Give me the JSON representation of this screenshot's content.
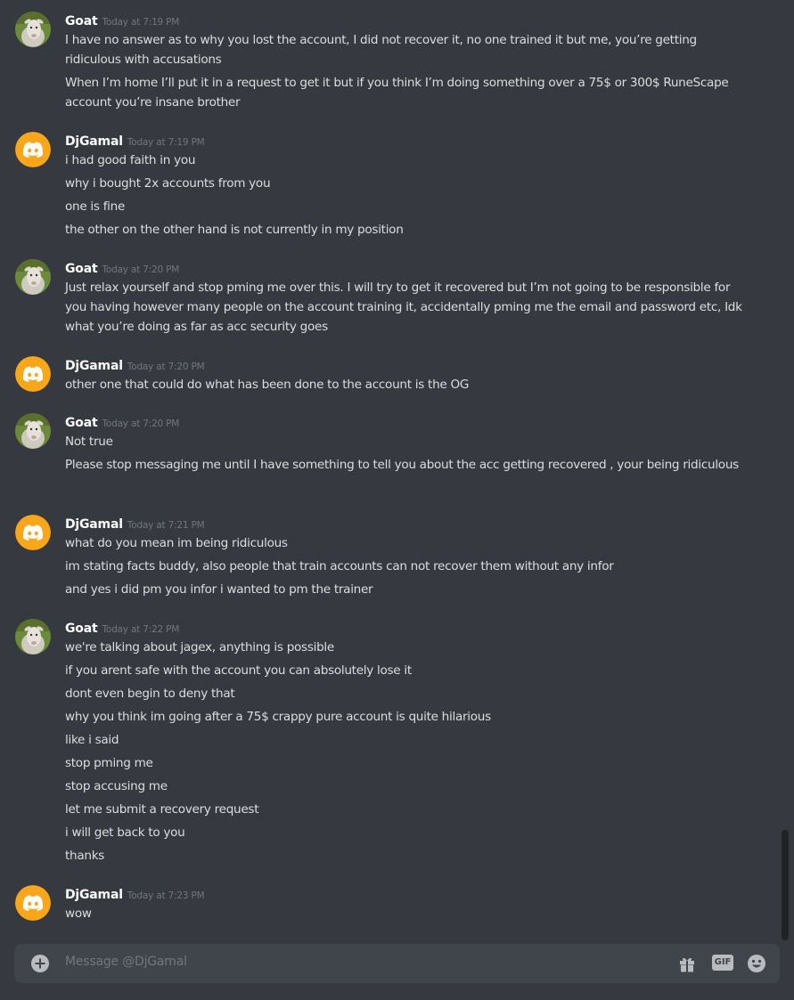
{
  "colors": {
    "background": "#36393f",
    "composer_bg": "#40444b",
    "username": "#ffffff",
    "timestamp": "#72767d",
    "text": "#dcddde",
    "discord_avatar": "#faa61a"
  },
  "conversation": [
    {
      "user": "Goat",
      "avatar": "goat-avatar",
      "time": "Today at 7:19 PM",
      "lines": [
        "I have no answer as to why you lost the account, I did not recover it, no one trained it but me, you’re getting ridiculous with accusations",
        "When I’m home I’ll put it in a request to get it but if you think I’m doing something over a 75$ or 300$ RuneScape account you’re insane brother"
      ]
    },
    {
      "user": "DjGamal",
      "avatar": "discord-avatar",
      "time": "Today at 7:19 PM",
      "lines": [
        "i had good faith in you",
        "why i bought 2x accounts from you",
        "one is fine",
        "the other on the other hand is not currently in my position"
      ]
    },
    {
      "user": "Goat",
      "avatar": "goat-avatar",
      "time": "Today at 7:20 PM",
      "lines": [
        "Just relax yourself and stop pming me over this. I will try to get it recovered but I’m not going to be responsible for you having however many people on the account training it, accidentally pming me the email and password etc, Idk what you’re doing as far as acc security goes"
      ]
    },
    {
      "user": "DjGamal",
      "avatar": "discord-avatar",
      "time": "Today at 7:20 PM",
      "lines": [
        "other one that could do what has been done to the account is the OG"
      ]
    },
    {
      "user": "Goat",
      "avatar": "goat-avatar",
      "time": "Today at 7:20 PM",
      "lines": [
        "Not true",
        "Please stop messaging me until I have something to tell you about the acc getting recovered , your being ridiculous"
      ]
    },
    {
      "user": "DjGamal",
      "avatar": "discord-avatar",
      "time": "Today at 7:21 PM",
      "lines": [
        "what do you mean im being ridiculous",
        "im stating facts buddy, also people that train accounts can not recover them without any infor",
        "and yes i did pm you infor i wanted to pm the trainer"
      ]
    },
    {
      "user": "Goat",
      "avatar": "goat-avatar",
      "time": "Today at 7:22 PM",
      "lines": [
        "we're talking about jagex, anything is possible",
        "if you arent safe with the account you can absolutely lose it",
        "dont even begin to deny that",
        "why you think im going after a 75$ crappy pure account is quite hilarious",
        "like i said",
        "stop pming me",
        "stop accusing me",
        "let me submit a recovery request",
        "i will get back to you",
        "thanks"
      ]
    },
    {
      "user": "DjGamal",
      "avatar": "discord-avatar",
      "time": "Today at 7:23 PM",
      "lines": [
        "wow"
      ]
    }
  ],
  "composer": {
    "placeholder": "Message @DjGamal",
    "gif_label": "GIF",
    "icons": [
      "plus-icon",
      "gift-icon",
      "gif-icon",
      "emoji-icon"
    ]
  }
}
